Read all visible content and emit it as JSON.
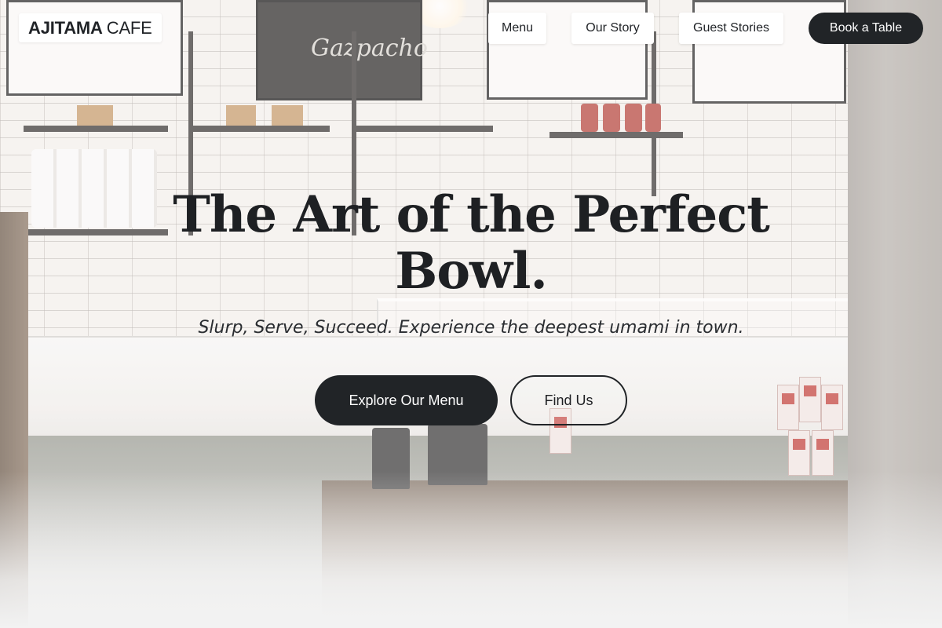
{
  "brand": {
    "name_bold": "AJITAMA",
    "name_light": "CAFE"
  },
  "nav": {
    "items": [
      {
        "label": "Menu"
      },
      {
        "label": "Our Story"
      },
      {
        "label": "Guest Stories"
      }
    ],
    "cta_label": "Book a Table"
  },
  "hero": {
    "title": "The Art of the Perfect Bowl.",
    "subtitle": "Slurp, Serve, Succeed. Experience the deepest umami in town.",
    "primary_button": "Explore Our Menu",
    "secondary_button": "Find Us"
  },
  "background": {
    "chalkboard_text": "Gazpacho"
  },
  "colors": {
    "primary_dark": "#212427",
    "text_dark": "#1e2023",
    "nav_bg": "#ffffff"
  }
}
